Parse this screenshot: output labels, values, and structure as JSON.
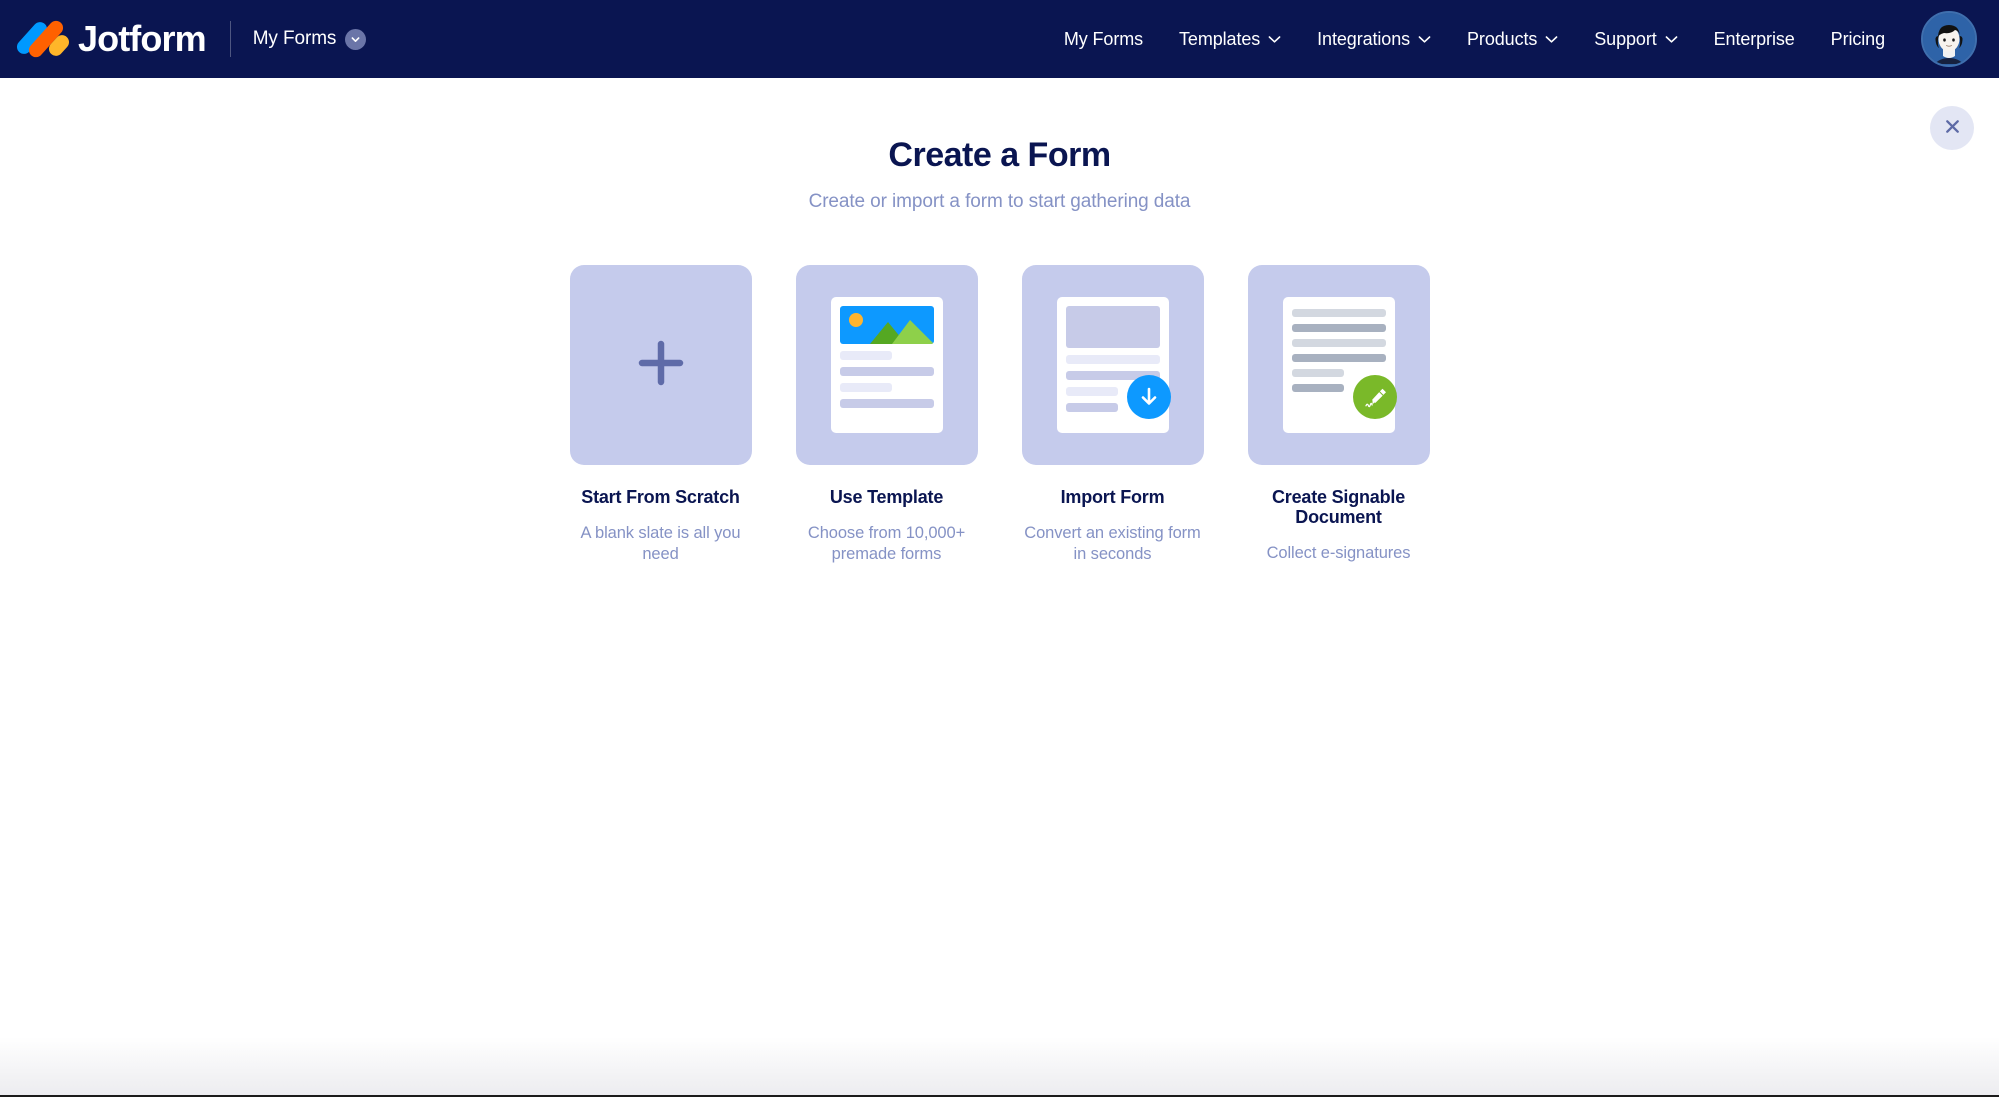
{
  "header": {
    "logo_text": "Jotform",
    "logo_icon": "jotform-logo-icon",
    "workspace_switcher": {
      "label": "My Forms",
      "chevron_icon": "chevron-down-icon"
    },
    "nav_items": [
      {
        "label": "My Forms",
        "has_caret": false
      },
      {
        "label": "Templates",
        "has_caret": true
      },
      {
        "label": "Integrations",
        "has_caret": true
      },
      {
        "label": "Products",
        "has_caret": true
      },
      {
        "label": "Support",
        "has_caret": true
      },
      {
        "label": "Enterprise",
        "has_caret": false
      },
      {
        "label": "Pricing",
        "has_caret": false
      }
    ],
    "avatar_icon": "user-avatar-icon",
    "background_color": "#0a1551"
  },
  "main": {
    "title": "Create a Form",
    "subtitle": "Create or import a form to start gathering data",
    "close_icon": "close-icon",
    "title_color": "#0a1551",
    "subtitle_color": "#8592c5",
    "card_background": "#c5cbec",
    "options": [
      {
        "title": "Start From Scratch",
        "description": "A blank slate is all you need",
        "icon": "plus-icon",
        "accent_color": "#5f6ba8"
      },
      {
        "title": "Use Template",
        "description": "Choose from 10,000+ premade forms",
        "icon": "template-document-icon",
        "accent_color": "#0d99ff"
      },
      {
        "title": "Import Form",
        "description": "Convert an existing form in seconds",
        "icon": "import-download-icon",
        "accent_color": "#0d99ff"
      },
      {
        "title": "Create Signable Document",
        "description": "Collect e-signatures",
        "icon": "signature-pen-icon",
        "accent_color": "#7ab929"
      }
    ]
  }
}
